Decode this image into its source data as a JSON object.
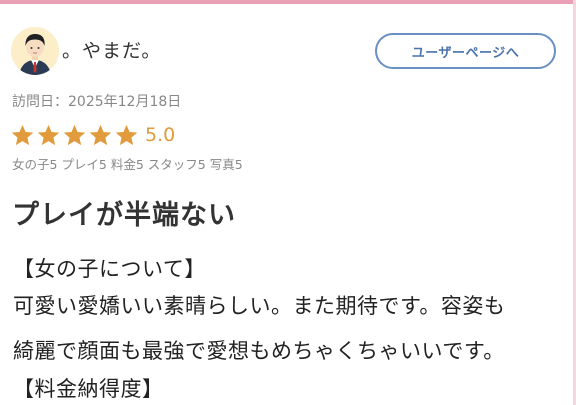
{
  "user": {
    "name": "。やまだ。",
    "page_button_label": "ユーザーページへ"
  },
  "review": {
    "visit_date": "訪問日：2025年12月18日",
    "star_count": 5,
    "rating": "5.0",
    "sub_ratings": "女の子5 プレイ5 料金5 スタッフ5 写真5",
    "title": "プレイが半端ない",
    "lines": [
      "【女の子について】",
      "可愛い愛嬌いい素晴らしい。また期待です。容姿も",
      "綺麗で顔面も最強で愛想もめちゃくちゃいいです。",
      "【料金納得度】"
    ]
  },
  "colors": {
    "accent_pink": "#e9a0b6",
    "button_blue": "#4b73ad",
    "star_orange": "#e19a3c",
    "avatar_bg": "#fbeec9"
  }
}
